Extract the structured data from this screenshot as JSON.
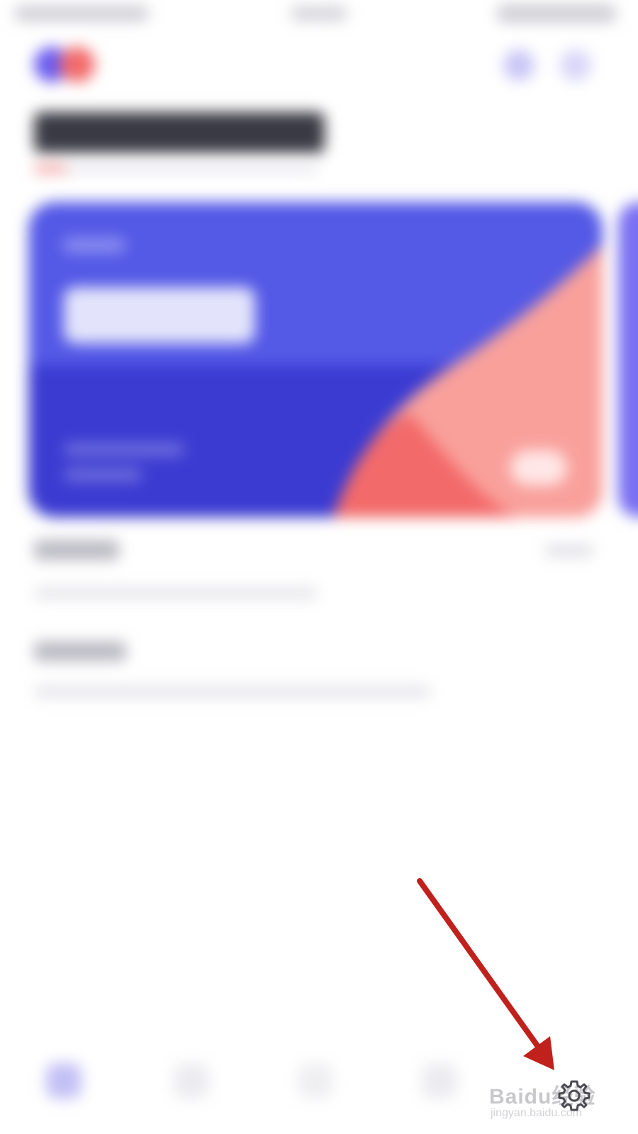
{
  "app": {
    "title_blurred": true
  },
  "colors": {
    "brand_purple": "#5459e6",
    "brand_dark": "#3b3bd2",
    "accent_coral": "#f36a6a",
    "accent_pink": "#f9a09b",
    "annotation_arrow": "#c0211c"
  },
  "tabbar": {
    "tabs": [
      {
        "icon": "home-icon",
        "active": true
      },
      {
        "icon": "tab-2-icon",
        "active": false
      },
      {
        "icon": "tab-3-icon",
        "active": false
      },
      {
        "icon": "tab-4-icon",
        "active": false
      },
      {
        "icon": "settings-icon",
        "active": false
      }
    ]
  },
  "watermark": {
    "brand": "Baidu经验",
    "sub": "jingyan.baidu.com"
  }
}
